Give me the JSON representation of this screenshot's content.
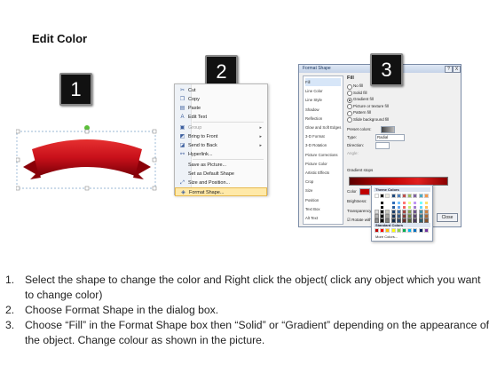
{
  "title": "Edit Color",
  "steps": {
    "s1": "1",
    "s2": "2",
    "s3": "3"
  },
  "context_menu": {
    "items": [
      {
        "label": "Cut",
        "icon": "scissors-icon",
        "glyph": "✂",
        "disabled": false,
        "arrow": false
      },
      {
        "label": "Copy",
        "icon": "copy-icon",
        "glyph": "❐",
        "disabled": false,
        "arrow": false
      },
      {
        "label": "Paste",
        "icon": "paste-icon",
        "glyph": "▤",
        "disabled": false,
        "arrow": false
      },
      {
        "label": "Edit Text",
        "icon": "edit-text-icon",
        "glyph": "A",
        "disabled": false,
        "arrow": false
      },
      {
        "label": "Group",
        "icon": "group-icon",
        "glyph": "▣",
        "disabled": true,
        "arrow": true
      },
      {
        "label": "Bring to Front",
        "icon": "bring-front-icon",
        "glyph": "◩",
        "disabled": false,
        "arrow": true
      },
      {
        "label": "Send to Back",
        "icon": "send-back-icon",
        "glyph": "◪",
        "disabled": false,
        "arrow": true
      },
      {
        "label": "Hyperlink...",
        "icon": "hyperlink-icon",
        "glyph": "⚯",
        "disabled": false,
        "arrow": false
      },
      {
        "label": "Save as Picture...",
        "icon": "",
        "glyph": "",
        "disabled": false,
        "arrow": false
      },
      {
        "label": "Set as Default Shape",
        "icon": "",
        "glyph": "",
        "disabled": false,
        "arrow": false
      },
      {
        "label": "Size and Position...",
        "icon": "size-icon",
        "glyph": "⤢",
        "disabled": false,
        "arrow": false
      },
      {
        "label": "Format Shape...",
        "icon": "format-shape-icon",
        "glyph": "◈",
        "disabled": false,
        "arrow": false,
        "highlighted": true
      }
    ]
  },
  "dialog": {
    "title": "Format Shape",
    "help": "?",
    "close_x": "X",
    "nav": [
      "Fill",
      "Line Color",
      "Line Style",
      "Shadow",
      "Reflection",
      "Glow and Soft Edges",
      "3-D Format",
      "3-D Rotation",
      "Picture Corrections",
      "Picture Color",
      "Artistic Effects",
      "Crop",
      "Size",
      "Position",
      "Text Box",
      "Alt Text"
    ],
    "section": "Fill",
    "options": [
      "No fill",
      "Solid fill",
      "Gradient fill",
      "Picture or texture fill",
      "Pattern fill",
      "Slide background fill"
    ],
    "preset_colors": "Preset colors:",
    "type_label": "Type:",
    "type_value": "Radial",
    "direction_label": "Direction:",
    "angle_label": "Angle:",
    "gradient_stops": "Gradient stops",
    "color_label": "Color",
    "position_label": "Position:",
    "position_value": "80%",
    "brightness_label": "Brightness:",
    "transparency_label": "Transparency:",
    "rotate_label": "Rotate with shape",
    "close_button": "Close"
  },
  "color_picker": {
    "theme_header": "Theme Colors",
    "standard_header": "Standard Colors",
    "more": "More Colors...",
    "theme_row": [
      "#ffffff",
      "#000000",
      "#eeece1",
      "#1f497d",
      "#4f81bd",
      "#c0504d",
      "#9bbb59",
      "#8064a2",
      "#4bacc6",
      "#f79646"
    ],
    "standard_row": [
      "#c00000",
      "#ff0000",
      "#ffc000",
      "#ffff00",
      "#92d050",
      "#00b050",
      "#00b0f0",
      "#0070c0",
      "#002060",
      "#7030a0"
    ]
  },
  "accent": "#c8101a",
  "instructions": [
    {
      "num": "1.",
      "text": "Select the shape to change the color and Right click the object( click any object which you want to change color)"
    },
    {
      "num": "2.",
      "text": "Choose Format Shape in the dialog box."
    },
    {
      "num": "3.",
      "text": "Choose “Fill” in the Format Shape box then “Solid” or “Gradient” depending on the appearance of the object. Change colour as shown in the picture."
    }
  ]
}
